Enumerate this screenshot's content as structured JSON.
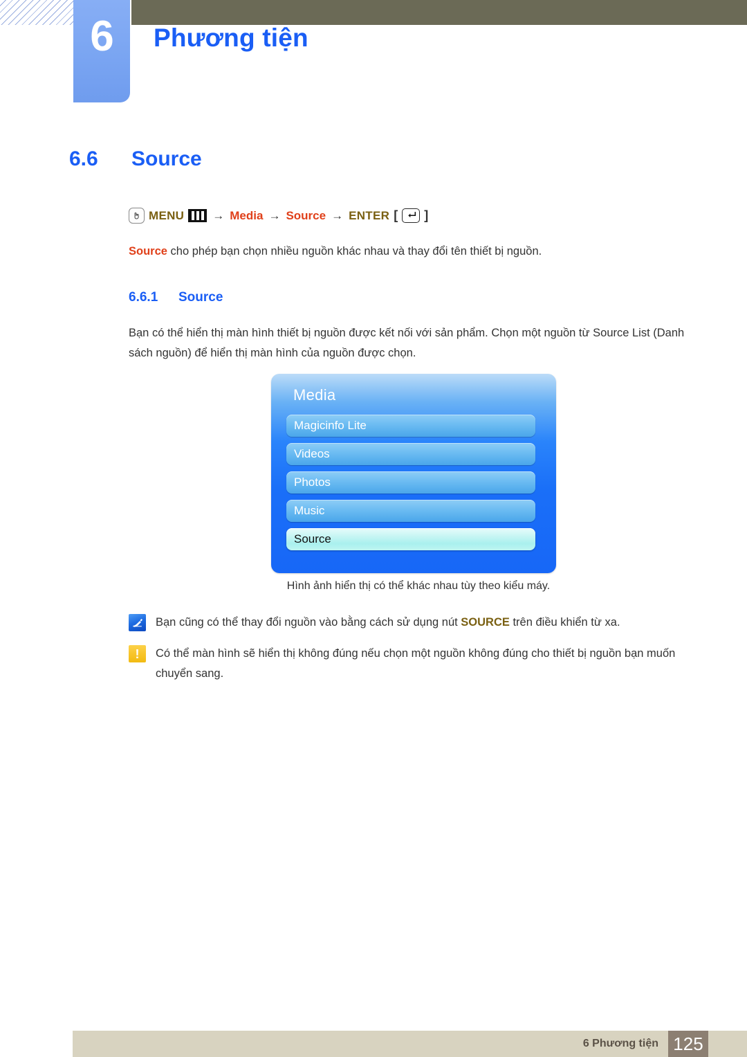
{
  "header": {
    "chapter_number": "6",
    "chapter_title": "Phương tiện"
  },
  "section": {
    "number": "6.6",
    "title": "Source"
  },
  "nav_path": {
    "hand_icon": "hand-press-icon",
    "menu_label": "MENU",
    "menu_icon": "menu-bars-icon",
    "arrow1": "→",
    "item1": "Media",
    "arrow2": "→",
    "item2": "Source",
    "arrow3": "→",
    "enter_label": "ENTER",
    "bracket_open": "[",
    "enter_icon": "enter-return-icon",
    "bracket_close": "]"
  },
  "source_desc": {
    "keyword": "Source",
    "rest": " cho phép bạn chọn nhiều nguồn khác nhau và thay đổi tên thiết bị nguồn."
  },
  "subsection": {
    "number": "6.6.1",
    "title": "Source"
  },
  "body_paragraph": "Bạn có thể hiển thị màn hình thiết bị nguồn được kết nối với sản phẩm. Chọn một nguồn từ Source List (Danh sách nguồn) để hiển thị màn hình của nguồn được chọn.",
  "osd": {
    "title": "Media",
    "items": [
      {
        "label": "Magicinfo Lite",
        "selected": false
      },
      {
        "label": "Videos",
        "selected": false
      },
      {
        "label": "Photos",
        "selected": false
      },
      {
        "label": "Music",
        "selected": false
      },
      {
        "label": "Source",
        "selected": true
      }
    ]
  },
  "caption": "Hình ảnh hiển thị có thể khác nhau tùy theo kiểu máy.",
  "notes": [
    {
      "icon": "note-pen-icon",
      "text_before": "Bạn cũng có thể thay đổi nguồn vào bằng cách sử dụng nút ",
      "keyword": "SOURCE",
      "text_after": " trên điều khiển từ xa."
    },
    {
      "icon": "caution-exclamation-icon",
      "text": "Có thể màn hình sẽ hiển thị không đúng nếu chọn một nguồn không đúng cho thiết bị nguồn bạn muốn chuyển sang."
    }
  ],
  "footer": {
    "label": "6 Phương tiện",
    "page_number": "125"
  },
  "colors": {
    "heading_blue": "#1a5ef5",
    "accent_red": "#e0401a",
    "accent_gold": "#7a6012",
    "olive_bar": "#6b6a56",
    "footer_bar": "#d8d3c0",
    "footer_page_box": "#8c7f72"
  }
}
